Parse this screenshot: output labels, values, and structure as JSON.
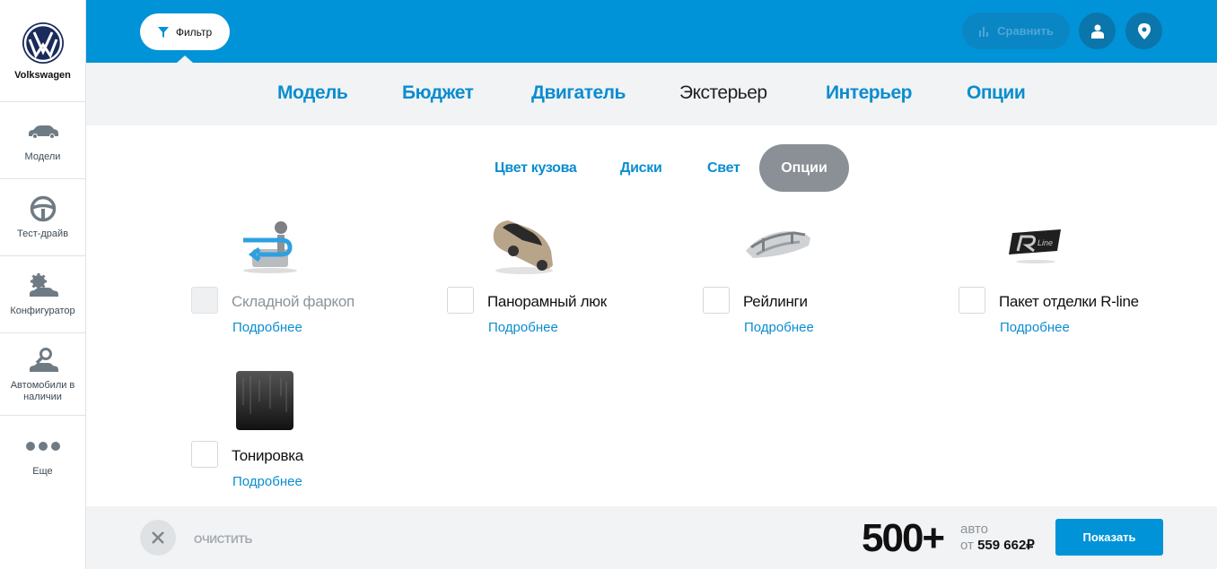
{
  "brand": {
    "name": "Volkswagen",
    "logo": "vw-logo"
  },
  "sidebar": {
    "items": [
      {
        "label": "Модели",
        "icon": "car-icon"
      },
      {
        "label": "Тест-драйв",
        "icon": "steering-wheel-icon"
      },
      {
        "label": "Конфигуратор",
        "icon": "car-gear-icon"
      },
      {
        "label": "Автомобили в наличии",
        "icon": "car-search-icon"
      },
      {
        "label": "Еще",
        "icon": "more-dots-icon"
      }
    ]
  },
  "topbar": {
    "filter_label": "Фильтр",
    "compare_label": "Сравнить",
    "user_icon": "user-icon",
    "location_icon": "location-pin-icon"
  },
  "tabs": [
    {
      "label": "Модель",
      "active": false
    },
    {
      "label": "Бюджет",
      "active": false
    },
    {
      "label": "Двигатель",
      "active": false
    },
    {
      "label": "Экстерьер",
      "active": true
    },
    {
      "label": "Интерьер",
      "active": false
    },
    {
      "label": "Опции",
      "active": false
    }
  ],
  "subtabs": [
    {
      "label": "Цвет кузова",
      "active": false
    },
    {
      "label": "Диски",
      "active": false
    },
    {
      "label": "Свет",
      "active": false
    },
    {
      "label": "Опции",
      "active": true
    }
  ],
  "options": [
    {
      "label": "Складной фаркоп",
      "more": "Подробнее",
      "checked": false,
      "disabled": true,
      "image": "towbar-image"
    },
    {
      "label": "Панорамный люк",
      "more": "Подробнее",
      "checked": false,
      "disabled": false,
      "image": "panoramic-roof-image"
    },
    {
      "label": "Рейлинги",
      "more": "Подробнее",
      "checked": false,
      "disabled": false,
      "image": "roof-rails-image"
    },
    {
      "label": "Пакет отделки R-line",
      "more": "Подробнее",
      "checked": false,
      "disabled": false,
      "image": "r-line-badge-image"
    },
    {
      "label": "Тонировка",
      "more": "Подробнее",
      "checked": false,
      "disabled": false,
      "image": "tinting-image"
    }
  ],
  "bottombar": {
    "clear_label": "ОЧИСТИТЬ",
    "count": "500+",
    "count_unit": "авто",
    "price_prefix": "от",
    "price": "559 662₽",
    "show_label": "Показать"
  },
  "colors": {
    "primary": "#0093d8",
    "tab_blue": "#0a8dd0",
    "active_pill": "#8a9096",
    "panel": "#f2f3f4"
  }
}
